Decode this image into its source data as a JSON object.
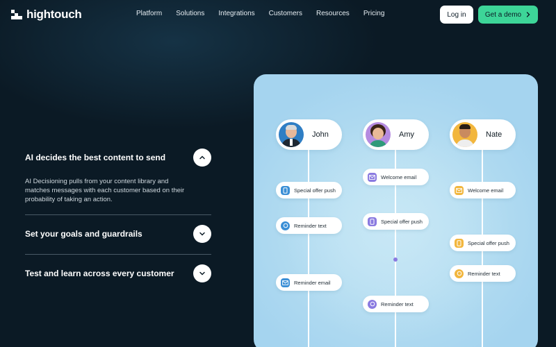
{
  "brand": {
    "name": "hightouch"
  },
  "nav": {
    "links": [
      "Platform",
      "Solutions",
      "Integrations",
      "Customers",
      "Resources",
      "Pricing"
    ],
    "login_label": "Log in",
    "demo_label": "Get a demo"
  },
  "accordion": [
    {
      "title": "AI decides the best content to send",
      "description": "AI Decisioning pulls from your content library and matches messages with each customer based on their probability of taking an action.",
      "expanded": true
    },
    {
      "title": "Set your goals and guardrails",
      "expanded": false
    },
    {
      "title": "Test and learn across every customer",
      "expanded": false
    }
  ],
  "journeys": [
    {
      "name": "John",
      "steps": [
        {
          "label": "Special offer push",
          "icon": "phone-icon"
        },
        {
          "label": "Reminder text",
          "icon": "chat-icon"
        },
        {
          "label": "Reminder email",
          "icon": "mail-icon"
        }
      ]
    },
    {
      "name": "Amy",
      "steps": [
        {
          "label": "Welcome email",
          "icon": "mail-icon"
        },
        {
          "label": "Special offer push",
          "icon": "phone-icon"
        },
        {
          "label": "Reminder text",
          "icon": "chat-icon"
        }
      ]
    },
    {
      "name": "Nate",
      "steps": [
        {
          "label": "Welcome email",
          "icon": "mail-icon"
        },
        {
          "label": "Special offer push",
          "icon": "phone-icon"
        },
        {
          "label": "Reminder text",
          "icon": "chat-icon"
        }
      ]
    }
  ],
  "colors": {
    "background": "#0b1a25",
    "accent_green": "#3dd598",
    "john_icon": "#3b8fd6",
    "amy_icon": "#8a7ae0",
    "nate_icon": "#f2b63d"
  }
}
